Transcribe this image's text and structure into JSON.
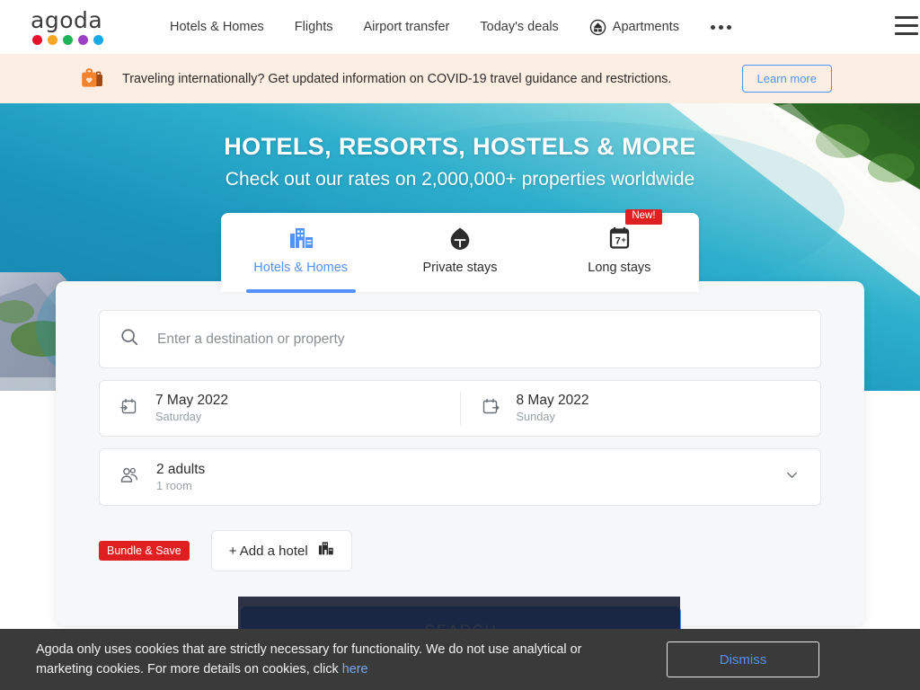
{
  "header": {
    "logo_text": "agoda",
    "logo_dot_colors": [
      "#e8112d",
      "#f5a623",
      "#21b35a",
      "#9b3fc4",
      "#19a9e6"
    ],
    "nav_items": [
      {
        "label": "Hotels & Homes",
        "icon": ""
      },
      {
        "label": "Flights",
        "icon": ""
      },
      {
        "label": "Airport transfer",
        "icon": ""
      },
      {
        "label": "Today's deals",
        "icon": ""
      },
      {
        "label": "Apartments",
        "icon": "apartments-icon"
      }
    ],
    "more_icon": "ellipsis-icon",
    "menu_icon": "hamburger-menu-icon"
  },
  "covid_banner": {
    "icon": "suitcase-heart-icon",
    "message": "Traveling internationally? Get updated information on COVID-19 travel guidance and restrictions.",
    "cta_label": "Learn more",
    "background": "#fdeee3",
    "cta_color": "#5392f9"
  },
  "hero": {
    "heading": "HOTELS, RESORTS, HOSTELS & MORE",
    "subheading": "Check out our rates on 2,000,000+ properties worldwide"
  },
  "tabs": [
    {
      "label": "Hotels & Homes",
      "icon": "hotel-building-icon",
      "active": true,
      "badge": ""
    },
    {
      "label": "Private stays",
      "icon": "house-circle-icon",
      "active": false,
      "badge": ""
    },
    {
      "label": "Long stays",
      "icon": "calendar-7plus-icon",
      "active": false,
      "badge": "New!"
    }
  ],
  "search": {
    "destination": {
      "icon": "search-icon",
      "value": "",
      "placeholder": "Enter a destination or property"
    },
    "check_in": {
      "icon": "calendar-arrow-in-icon",
      "date": "7 May 2022",
      "weekday": "Saturday"
    },
    "check_out": {
      "icon": "calendar-arrow-out-icon",
      "date": "8 May 2022",
      "weekday": "Sunday"
    },
    "occupancy": {
      "icon": "people-icon",
      "guests": "2 adults",
      "rooms": "1 room",
      "chevron": "chevron-down-icon"
    },
    "bundle_badge": "Bundle & Save",
    "add_hotel_label": "+ Add a hotel",
    "add_hotel_icon": "building-icon",
    "search_button": "SEARCH",
    "accent_color": "#5392f9",
    "badge_color": "#e02020"
  },
  "cookie_banner": {
    "text_part1": "Agoda only uses cookies that are strictly necessary for functionality. We do not use analytical or marketing cookies. For more details on cookies, click ",
    "link_label": "here",
    "dismiss_label": "Dismiss",
    "background": "#3a3a3a"
  }
}
